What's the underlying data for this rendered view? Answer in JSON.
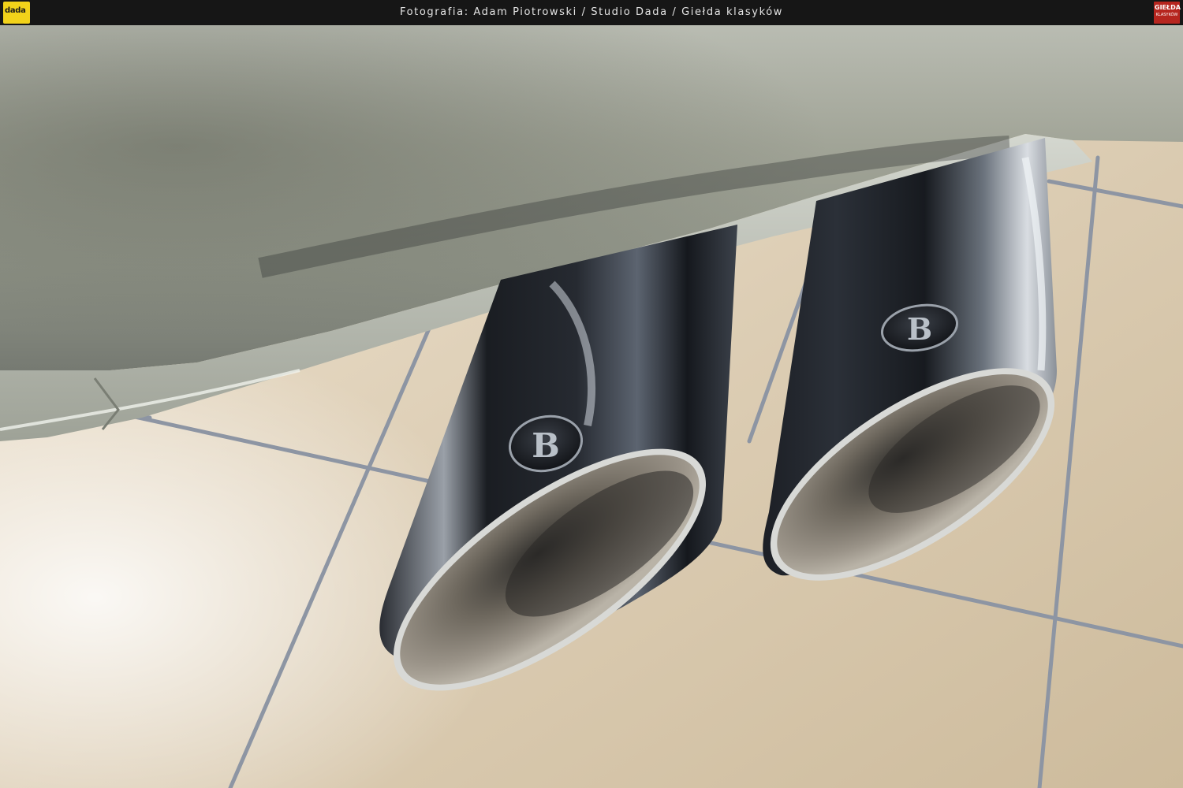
{
  "header": {
    "credit": "Fotografia: Adam Piotrowski / Studio Dada / Giełda klasyków",
    "logo_left": "dada",
    "logo_right_title": "GIEŁDA",
    "logo_right_subtitle": "KLASYKÓW"
  },
  "photo": {
    "emblem_left": "B",
    "emblem_right": "B"
  },
  "colors": {
    "bar": "#161616",
    "tile": "#d9cbb4",
    "grout": "#8d95a3",
    "bumper": "#a2a69a",
    "chrome_dark": "#1c1f26",
    "logo_yellow": "#f2d21a",
    "logo_red": "#b6251e"
  }
}
